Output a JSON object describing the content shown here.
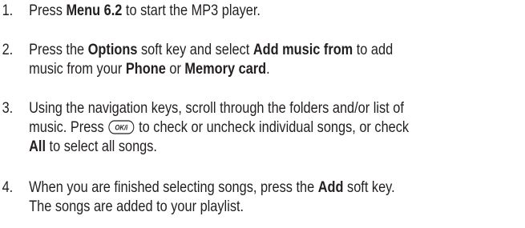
{
  "steps": [
    {
      "number": "1.",
      "lines": [
        [
          "Press ",
          "Menu 6.2",
          " to start the MP3 player."
        ]
      ]
    },
    {
      "number": "2.",
      "lines": [
        [
          "Press the ",
          "Options",
          " soft key and select ",
          "Add music from",
          " to add"
        ],
        [
          "music from your ",
          "Phone",
          " or ",
          "Memory card",
          "."
        ]
      ]
    },
    {
      "number": "3.",
      "lines": [
        [
          "Using the navigation keys, scroll through the folders and/or list of"
        ],
        [
          "music. Press ",
          " to check or uncheck individual songs, or check"
        ],
        [
          "All",
          " to select all songs."
        ]
      ],
      "key_label": "OK/i"
    },
    {
      "number": "4.",
      "lines": [
        [
          "When you are finished selecting songs, press the ",
          "Add",
          " soft key."
        ],
        [
          "The songs are added to your playlist."
        ]
      ]
    }
  ]
}
